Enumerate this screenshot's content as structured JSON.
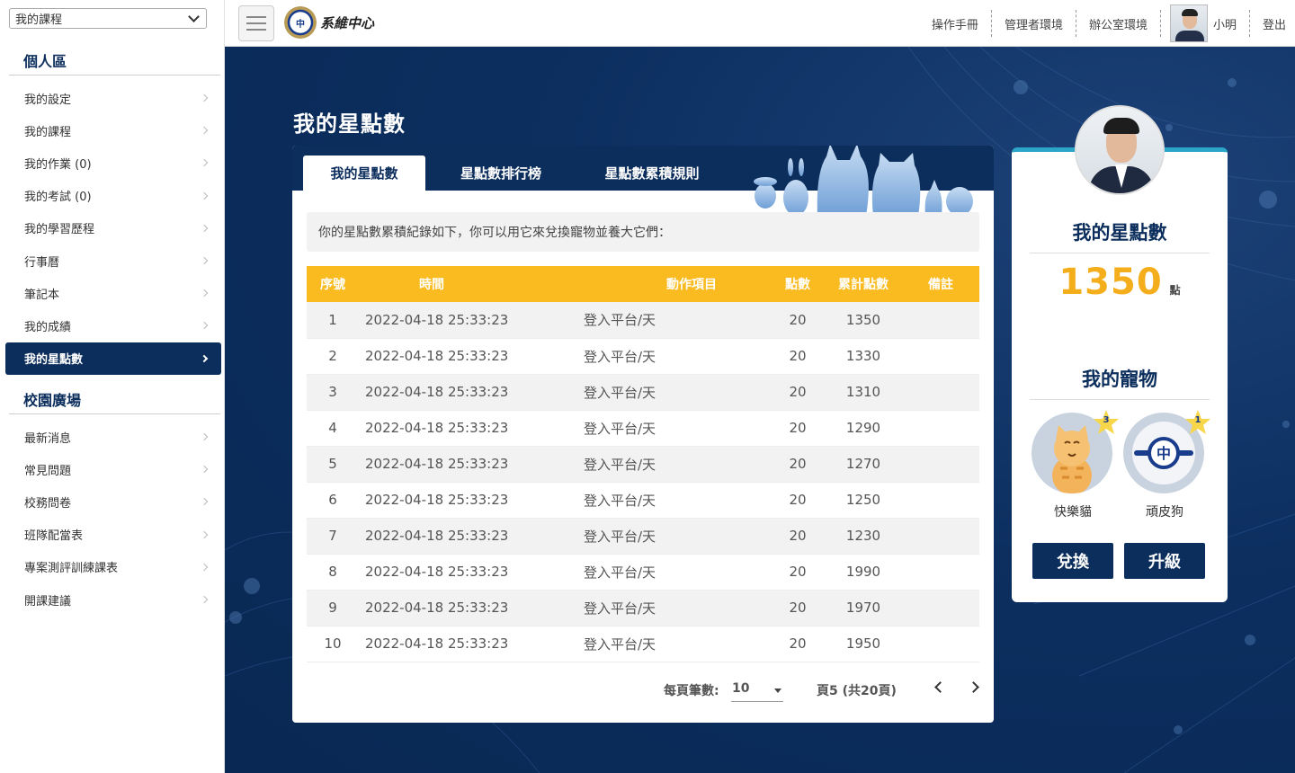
{
  "sidebar": {
    "course_select": "我的課程",
    "section1": "個人區",
    "items1": [
      {
        "label": "我的設定"
      },
      {
        "label": "我的課程"
      },
      {
        "label": "我的作業 (0)"
      },
      {
        "label": "我的考試 (0)"
      },
      {
        "label": "我的學習歷程"
      },
      {
        "label": "行事曆"
      },
      {
        "label": "筆記本"
      },
      {
        "label": "我的成績"
      },
      {
        "label": "我的星點數",
        "active": true
      }
    ],
    "section2": "校園廣場",
    "items2": [
      {
        "label": "最新消息"
      },
      {
        "label": "常見問題"
      },
      {
        "label": "校務問卷"
      },
      {
        "label": "班隊配當表"
      },
      {
        "label": "專案測評訓練課表"
      },
      {
        "label": "開課建議"
      }
    ]
  },
  "header": {
    "logo_seal": "中",
    "logo_text": "系維中心",
    "links": [
      "操作手冊",
      "管理者環境",
      "辦公室環境"
    ],
    "user_name": "小明",
    "logout": "登出"
  },
  "main": {
    "page_title": "我的星點數",
    "tabs": [
      "我的星點數",
      "星點數排行榜",
      "星點數累積規則"
    ],
    "active_tab": 0,
    "info_text": "你的星點數累積紀錄如下，你可以用它來兌換寵物並養大它們：",
    "table": {
      "headers": [
        "序號",
        "時間",
        "動作項目",
        "點數",
        "累計點數",
        "備註"
      ],
      "rows": [
        [
          "1",
          "2022-04-18 25:33:23",
          "登入平台/天",
          "20",
          "1350",
          ""
        ],
        [
          "2",
          "2022-04-18 25:33:23",
          "登入平台/天",
          "20",
          "1330",
          ""
        ],
        [
          "3",
          "2022-04-18 25:33:23",
          "登入平台/天",
          "20",
          "1310",
          ""
        ],
        [
          "4",
          "2022-04-18 25:33:23",
          "登入平台/天",
          "20",
          "1290",
          ""
        ],
        [
          "5",
          "2022-04-18 25:33:23",
          "登入平台/天",
          "20",
          "1270",
          ""
        ],
        [
          "6",
          "2022-04-18 25:33:23",
          "登入平台/天",
          "20",
          "1250",
          ""
        ],
        [
          "7",
          "2022-04-18 25:33:23",
          "登入平台/天",
          "20",
          "1230",
          ""
        ],
        [
          "8",
          "2022-04-18 25:33:23",
          "登入平台/天",
          "20",
          "1990",
          ""
        ],
        [
          "9",
          "2022-04-18 25:33:23",
          "登入平台/天",
          "20",
          "1970",
          ""
        ],
        [
          "10",
          "2022-04-18 25:33:23",
          "登入平台/天",
          "20",
          "1950",
          ""
        ]
      ]
    },
    "pager": {
      "per_page_label": "每頁筆數:",
      "per_page_value": "10",
      "page_info": "頁5 (共20頁)"
    }
  },
  "card": {
    "title": "我的星點數",
    "points": "1350",
    "unit": "點",
    "pets_title": "我的寵物",
    "pets": [
      {
        "name": "快樂貓",
        "level": "3"
      },
      {
        "name": "頑皮狗",
        "level": "1"
      }
    ],
    "btn_exchange": "兌換",
    "btn_upgrade": "升級"
  },
  "colors": {
    "navy": "#0c2e5c",
    "table_header": "#f9bb1f",
    "points": "#f5ae1b",
    "card_accent": "#2ba5c8"
  }
}
